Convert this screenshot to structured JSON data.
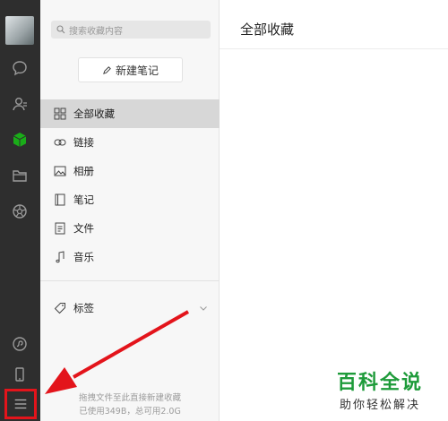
{
  "sidebar_rail": {
    "icons": [
      "chat-icon",
      "contacts-icon",
      "favorites-cube-icon",
      "folder-icon",
      "moments-icon",
      "mini-program-icon",
      "phone-icon",
      "menu-icon"
    ],
    "accent": "#1aad19"
  },
  "panel": {
    "search_placeholder": "搜索收藏内容",
    "new_note_label": "新建笔记",
    "nav": [
      {
        "label": "全部收藏",
        "icon": "grid-icon",
        "active": true
      },
      {
        "label": "链接",
        "icon": "link-icon"
      },
      {
        "label": "相册",
        "icon": "image-icon"
      },
      {
        "label": "笔记",
        "icon": "note-icon"
      },
      {
        "label": "文件",
        "icon": "file-icon"
      },
      {
        "label": "音乐",
        "icon": "music-icon"
      }
    ],
    "tags_label": "标签",
    "footer_line1": "拖拽文件至此直接新建收藏",
    "footer_line2": "已使用349B，总可用2.0G"
  },
  "main": {
    "title": "全部收藏"
  },
  "watermark": {
    "title": "百科全说",
    "subtitle": "助你轻松解决",
    "color": "#1e9b3a"
  },
  "annotation": {
    "highlight_color": "#e3141b"
  }
}
